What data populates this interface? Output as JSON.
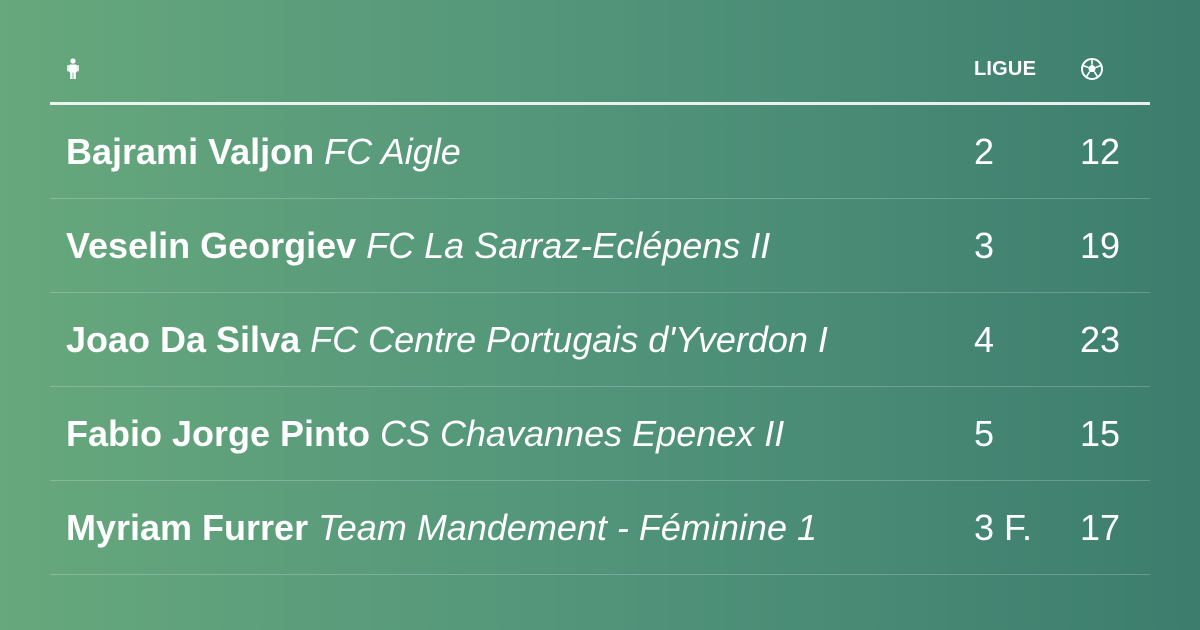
{
  "table": {
    "header": {
      "player_icon": "person-icon",
      "league_label": "LIGUE",
      "goals_icon": "soccer-ball-icon"
    },
    "rows": [
      {
        "player": "Bajrami Valjon",
        "club": "FC Aigle",
        "league": "2",
        "goals": "12"
      },
      {
        "player": "Veselin Georgiev",
        "club": "FC La Sarraz-Eclépens II",
        "league": "3",
        "goals": "19"
      },
      {
        "player": "Joao Da Silva",
        "club": "FC Centre Portugais d'Yverdon I",
        "league": "4",
        "goals": "23"
      },
      {
        "player": "Fabio Jorge Pinto",
        "club": "CS Chavannes Epenex II",
        "league": "5",
        "goals": "15"
      },
      {
        "player": "Myriam Furrer",
        "club": "Team Mandement - Féminine 1",
        "league": "3 F.",
        "goals": "17"
      }
    ]
  },
  "colors": {
    "background_start": "#67a87c",
    "background_end": "#3c7d6d",
    "text": "#ffffff"
  }
}
